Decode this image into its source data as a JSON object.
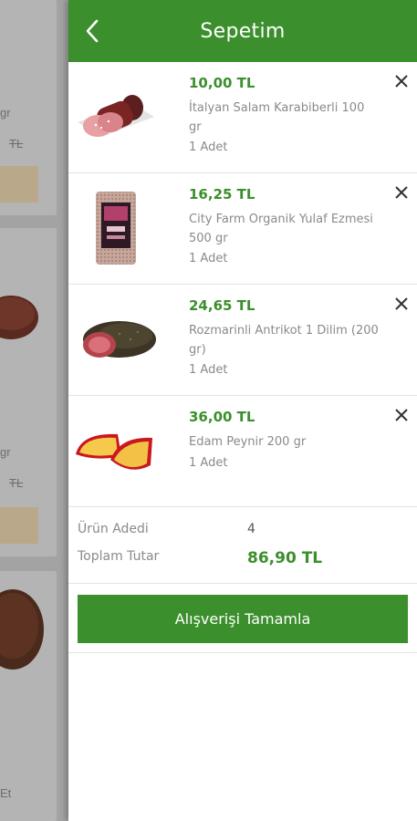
{
  "header": {
    "title": "Sepetim"
  },
  "cart_items": [
    {
      "price": "10,00 TL",
      "name": "İtalyan Salam Karabiberli 100 gr",
      "quantity": "1 Adet"
    },
    {
      "price": "16,25 TL",
      "name": "City Farm Organik Yulaf Ezmesi 500 gr",
      "quantity": "1 Adet"
    },
    {
      "price": "24,65 TL",
      "name": "Rozmarinli Antrikot 1 Dilim (200 gr)",
      "quantity": "1 Adet"
    },
    {
      "price": "36,00 TL",
      "name": "Edam Peynir 200 gr",
      "quantity": "1 Adet"
    }
  ],
  "summary": {
    "count_label": "Ürün Adedi",
    "count_value": "4",
    "total_label": "Toplam Tutar",
    "total_value": "86,90 TL"
  },
  "checkout": {
    "label": "Alışverişi Tamamla"
  },
  "background": {
    "fragments": [
      "gr",
      "TL",
      "gr",
      "TL",
      "Et"
    ]
  },
  "colors": {
    "brand_green": "#3b8f2c",
    "muted_text": "#8a8a8a"
  }
}
